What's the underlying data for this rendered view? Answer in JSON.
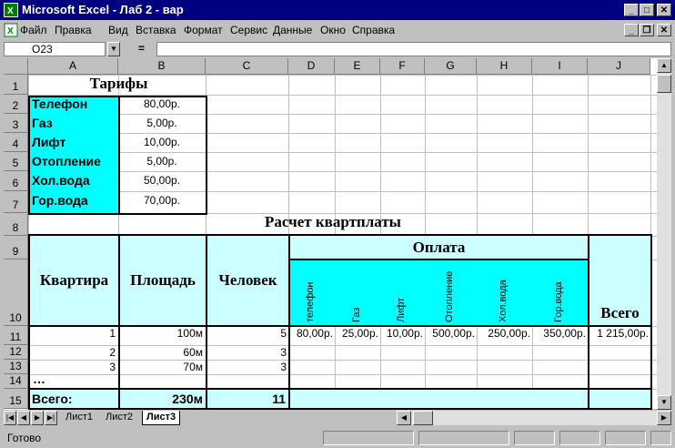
{
  "window": {
    "title": "Microsoft Excel - Лаб 2 - вар"
  },
  "menu": [
    "Файл",
    "Правка",
    "Вид",
    "Вставка",
    "Формат",
    "Сервис",
    "Данные",
    "Окно",
    "Справка"
  ],
  "formula_bar": {
    "name_box": "O23",
    "eq": "="
  },
  "columns": [
    "A",
    "B",
    "C",
    "D",
    "E",
    "F",
    "G",
    "H",
    "I",
    "J"
  ],
  "rows": [
    "1",
    "2",
    "3",
    "4",
    "5",
    "6",
    "7",
    "8",
    "9",
    "10",
    "11",
    "12",
    "13",
    "14",
    "15"
  ],
  "tariffs": {
    "title": "Тарифы",
    "items": [
      {
        "name": "Телефон",
        "value": "80,00р."
      },
      {
        "name": "Газ",
        "value": "5,00р."
      },
      {
        "name": "Лифт",
        "value": "10,00р."
      },
      {
        "name": "Отопление",
        "value": "5,00р."
      },
      {
        "name": "Хол.вода",
        "value": "50,00р."
      },
      {
        "name": "Гор.вода",
        "value": "70,00р."
      }
    ]
  },
  "calc": {
    "title": "Расчет квартплаты",
    "headers": {
      "apartment": "Квартира",
      "area": "Площадь",
      "people": "Человек",
      "payment": "Оплата",
      "total": "Всего"
    },
    "payment_cols": [
      "телефон",
      "Газ",
      "Лифт",
      "Отопление",
      "Хол.вода",
      "Гор.вода"
    ],
    "rows": [
      {
        "apt": "1",
        "area": "100м",
        "people": "5",
        "pay": [
          "80,00р.",
          "25,00р.",
          "10,00р.",
          "500,00р.",
          "250,00р.",
          "350,00р."
        ],
        "total": "1 215,00р."
      },
      {
        "apt": "2",
        "area": "60м",
        "people": "3",
        "pay": [
          "",
          "",
          "",
          "",
          "",
          ""
        ],
        "total": ""
      },
      {
        "apt": "3",
        "area": "70м",
        "people": "3",
        "pay": [
          "",
          "",
          "",
          "",
          "",
          ""
        ],
        "total": ""
      }
    ],
    "ellipsis": "…",
    "sum": {
      "label": "Всего:",
      "area": "230м",
      "people": "11"
    }
  },
  "sheets": [
    "Лист1",
    "Лист2",
    "Лист3"
  ],
  "active_sheet": "Лист3",
  "status": {
    "text": "Готово"
  }
}
